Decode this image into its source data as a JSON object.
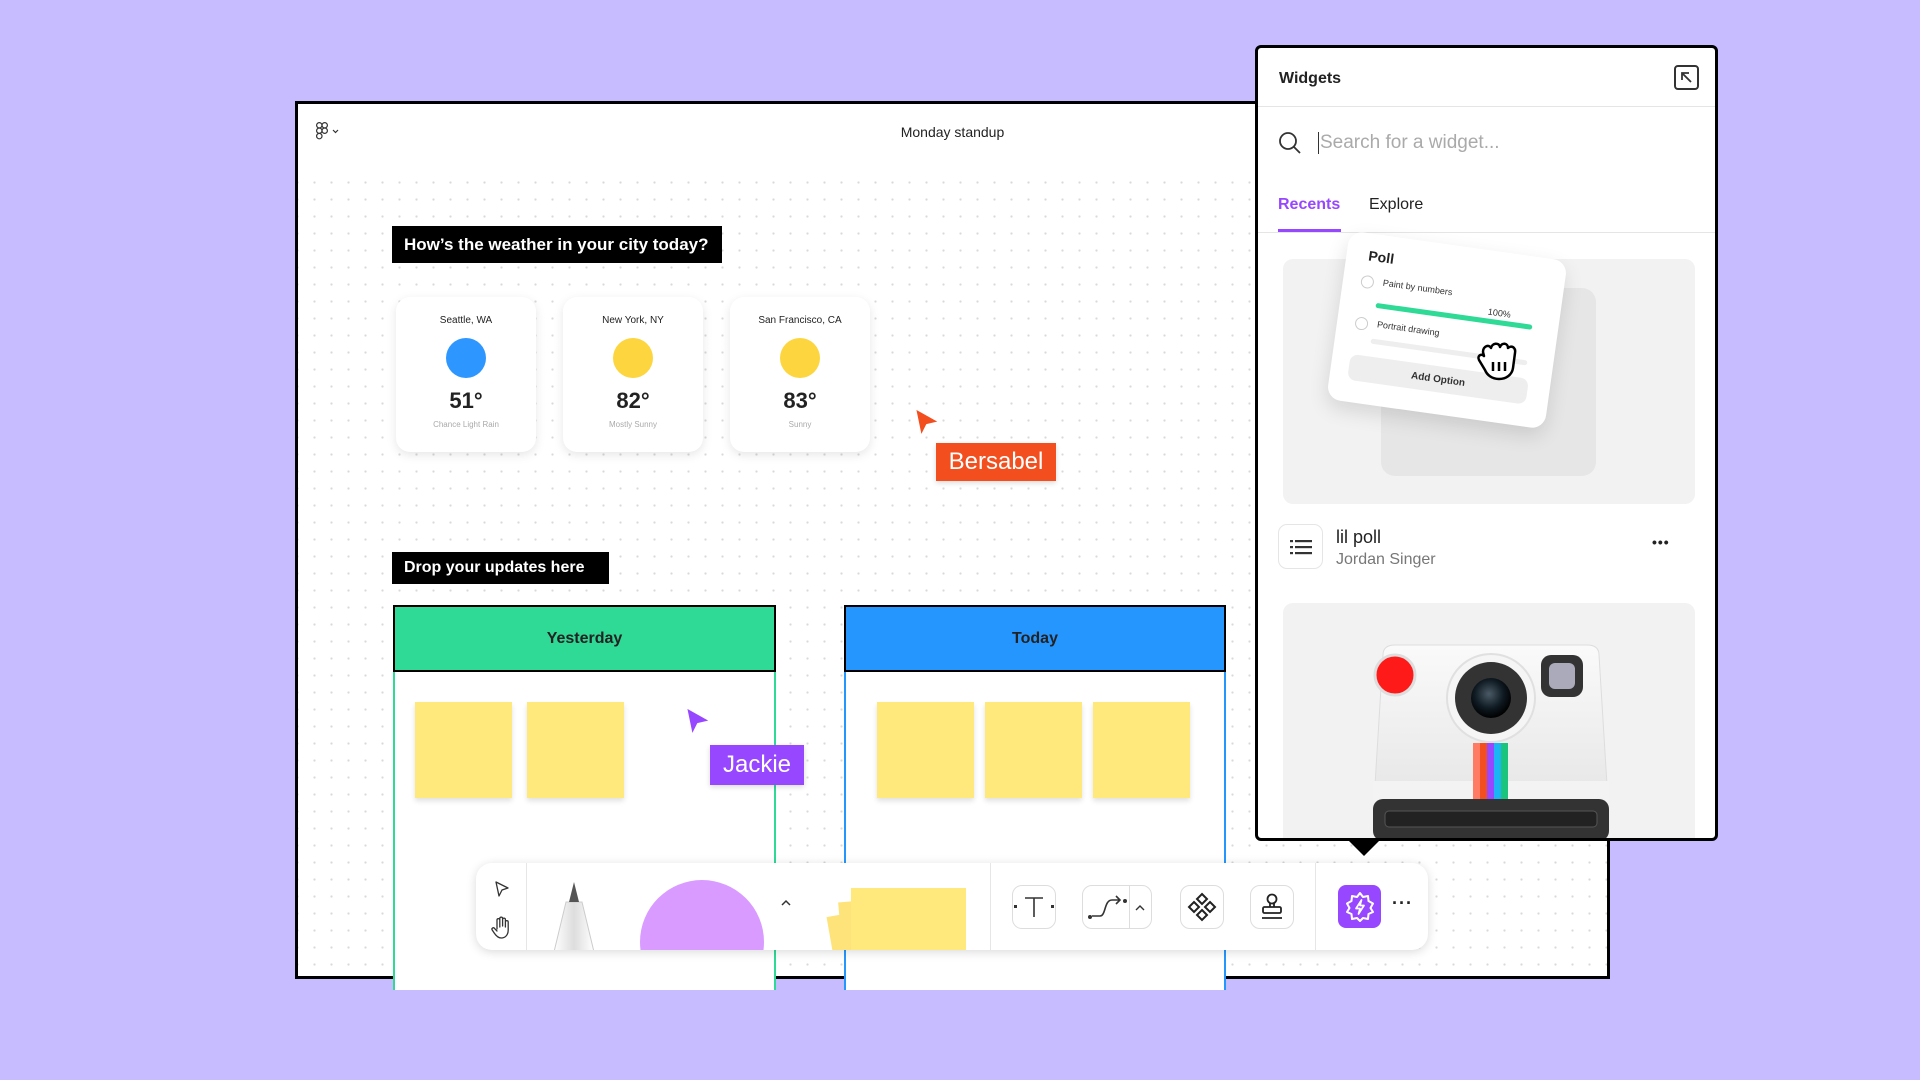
{
  "canvas": {
    "title": "Monday standup",
    "weather_heading": "How’s the weather in your city today?",
    "weather_cards": [
      {
        "city": "Seattle, WA",
        "temp": "51°",
        "condition": "Chance Light Rain",
        "color": "#2d96ff"
      },
      {
        "city": "New York, NY",
        "temp": "82°",
        "condition": "Mostly Sunny",
        "color": "#fcd53f"
      },
      {
        "city": "San Francisco, CA",
        "temp": "83°",
        "condition": "Sunny",
        "color": "#fcd53f"
      }
    ],
    "updates_heading": "Drop your updates here",
    "columns": [
      {
        "label": "Yesterday",
        "color": "#2fd996",
        "stickies": 2
      },
      {
        "label": "Today",
        "color": "#2696ff",
        "stickies": 3
      }
    ],
    "cursors": [
      {
        "name": "Bersabel",
        "color": "#f24e1e"
      },
      {
        "name": "Jackie",
        "color": "#9747ff"
      }
    ]
  },
  "toolbar": {
    "tools": [
      "move-tool",
      "hand-tool",
      "marker-tool",
      "shape-tool",
      "sticky-note-tool",
      "text-tool",
      "connector-tool",
      "component-tool",
      "stamp-tool",
      "widget-tool",
      "more"
    ],
    "accent": "#9747ff",
    "more_label": "···"
  },
  "widgets_panel": {
    "title": "Widgets",
    "search_placeholder": "Search for a widget...",
    "tabs": [
      {
        "label": "Recents",
        "active": true
      },
      {
        "label": "Explore",
        "active": false
      }
    ],
    "poll_preview": {
      "title": "Poll",
      "options": [
        {
          "label": "Paint by numbers",
          "percent": "100%",
          "fill": 1.0
        },
        {
          "label": "Portrait drawing",
          "percent": "",
          "fill": 0.0
        }
      ],
      "add_option": "Add Option"
    },
    "items": [
      {
        "name": "lil poll",
        "author": "Jordan Singer",
        "more_label": "•••"
      }
    ]
  }
}
